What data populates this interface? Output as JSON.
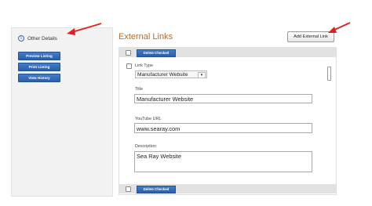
{
  "sidebar": {
    "section_label": "Other Details",
    "buttons": [
      "Preview Listing",
      "Print Listing",
      "View History"
    ]
  },
  "main": {
    "title": "External Links",
    "add_button": "Add External Link",
    "delete_button": "Delete Checked",
    "link_type_label": "Link Type",
    "link_type_value": "Manufacturer Website",
    "title_label": "Title",
    "title_value": "Manufacturer Website",
    "youtube_label": "YouTube URL",
    "youtube_value": "www.searay.com",
    "description_label": "Description",
    "description_value": "Sea Ray Website"
  },
  "colors": {
    "annotation_arrow": "#e02020",
    "title": "#b86a2a",
    "button_blue": "#2f6bbf"
  },
  "icons": [
    "info-icon",
    "chevron-down-icon",
    "arrow-annotation-icon"
  ]
}
